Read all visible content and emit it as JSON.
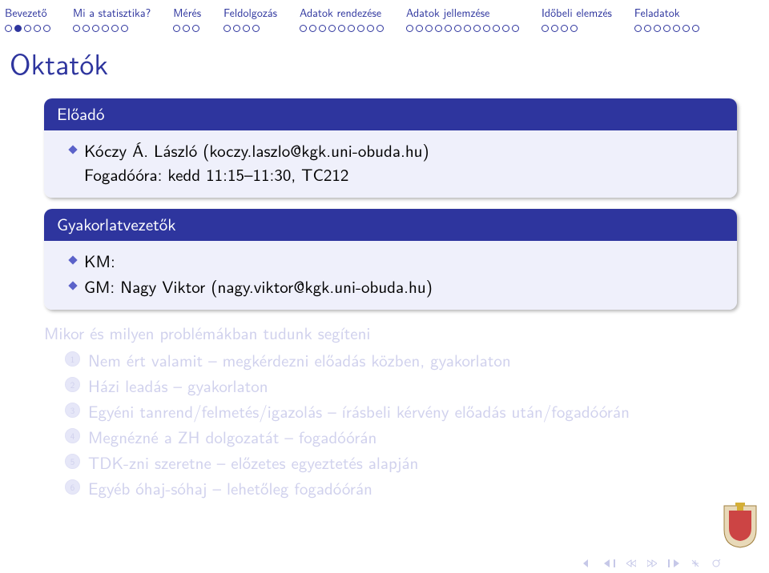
{
  "sections": [
    {
      "label": "Bevezető",
      "pips": 5,
      "current": 1
    },
    {
      "label": "Mi a statisztika?",
      "pips": 6,
      "current": -1
    },
    {
      "label": "Mérés",
      "pips": 3,
      "current": -1
    },
    {
      "label": "Feldolgozás",
      "pips": 4,
      "current": -1
    },
    {
      "label": "Adatok rendezése",
      "pips": 9,
      "current": -1
    },
    {
      "label": "Adatok jellemzése",
      "pips": 12,
      "current": -1
    },
    {
      "label": "Időbeli elemzés",
      "pips": 4,
      "current": -1
    },
    {
      "label": "Feladatok",
      "pips": 7,
      "current": -1
    }
  ],
  "title": "Oktatók",
  "block1": {
    "header": "Előadó",
    "name": "Kóczy Á. László (koczy.laszlo@kgk.uni-obuda.hu)",
    "office": "Fogadóóra: kedd 11:15–11:30, TC212"
  },
  "block2": {
    "header": "Gyakorlatvezetők",
    "km": "KM:",
    "gm": "GM: Nagy Viktor (nagy.viktor@kgk.uni-obuda.hu)"
  },
  "faded": {
    "subhead": "Mikor és milyen problémákban tudunk segíteni",
    "items": [
      "Nem ért valamit – megkérdezni előadás közben, gyakorlaton",
      "Házi leadás – gyakorlaton",
      "Egyéni tanrend/felmetés/igazolás – írásbeli kérvény előadás után/fogadóórán",
      "Megnézné a ZH dolgozatát – fogadóórán",
      "TDK-zni szeretne – előzetes egyeztetés alapján",
      "Egyéb óhaj-sóhaj – lehetőleg fogadóórán"
    ]
  }
}
